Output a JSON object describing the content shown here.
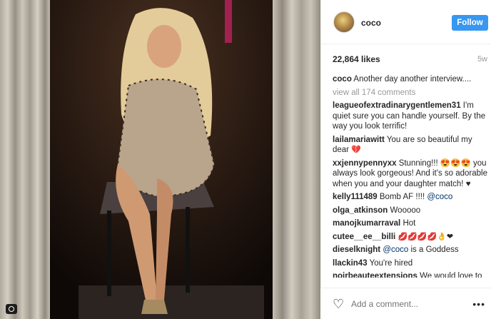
{
  "post": {
    "username": "coco",
    "follow_label": "Follow",
    "likes": "22,864 likes",
    "time": "5w"
  },
  "comments": [
    {
      "user": "coco",
      "text": "Another day another interview...."
    },
    {
      "user": "leagueofextradinarygentlemen31",
      "text": "I'm quiet sure you can handle yourself. By the way you look terrific!"
    },
    {
      "user": "lailamariawitt",
      "text": "You are so beautiful my dear"
    },
    {
      "user": "xxjennypennyxx",
      "text": "Stunning!!! 😍😍😍 you always look gorgeous! And it's so adorable when you and your daughter match!"
    },
    {
      "user": "kelly111489",
      "text": "Bomb AF !!!! ",
      "mention": "@coco"
    },
    {
      "user": "olga_atkinson",
      "text": "Wooooo"
    },
    {
      "user": "manojkumarraval",
      "text": "Hot"
    },
    {
      "user": "cutee__ee__billi",
      "text": "💋💋💋💋👌❤"
    },
    {
      "user": "dieselknight",
      "mention": "@coco",
      "text": " is a Goddess"
    },
    {
      "user": "llackin43",
      "text": "You're hired"
    },
    {
      "user": "noirbeauteextensions",
      "text": "We would love to"
    }
  ],
  "view_all": "view all 174 comments",
  "add_comment_placeholder": "Add a comment...",
  "icons": {
    "heart": "heart-outline-icon",
    "more": "more-options-icon",
    "camera": "camera-icon"
  },
  "colors": {
    "follow_bg": "#3897f0",
    "mention": "#003569",
    "muted": "#999999"
  }
}
